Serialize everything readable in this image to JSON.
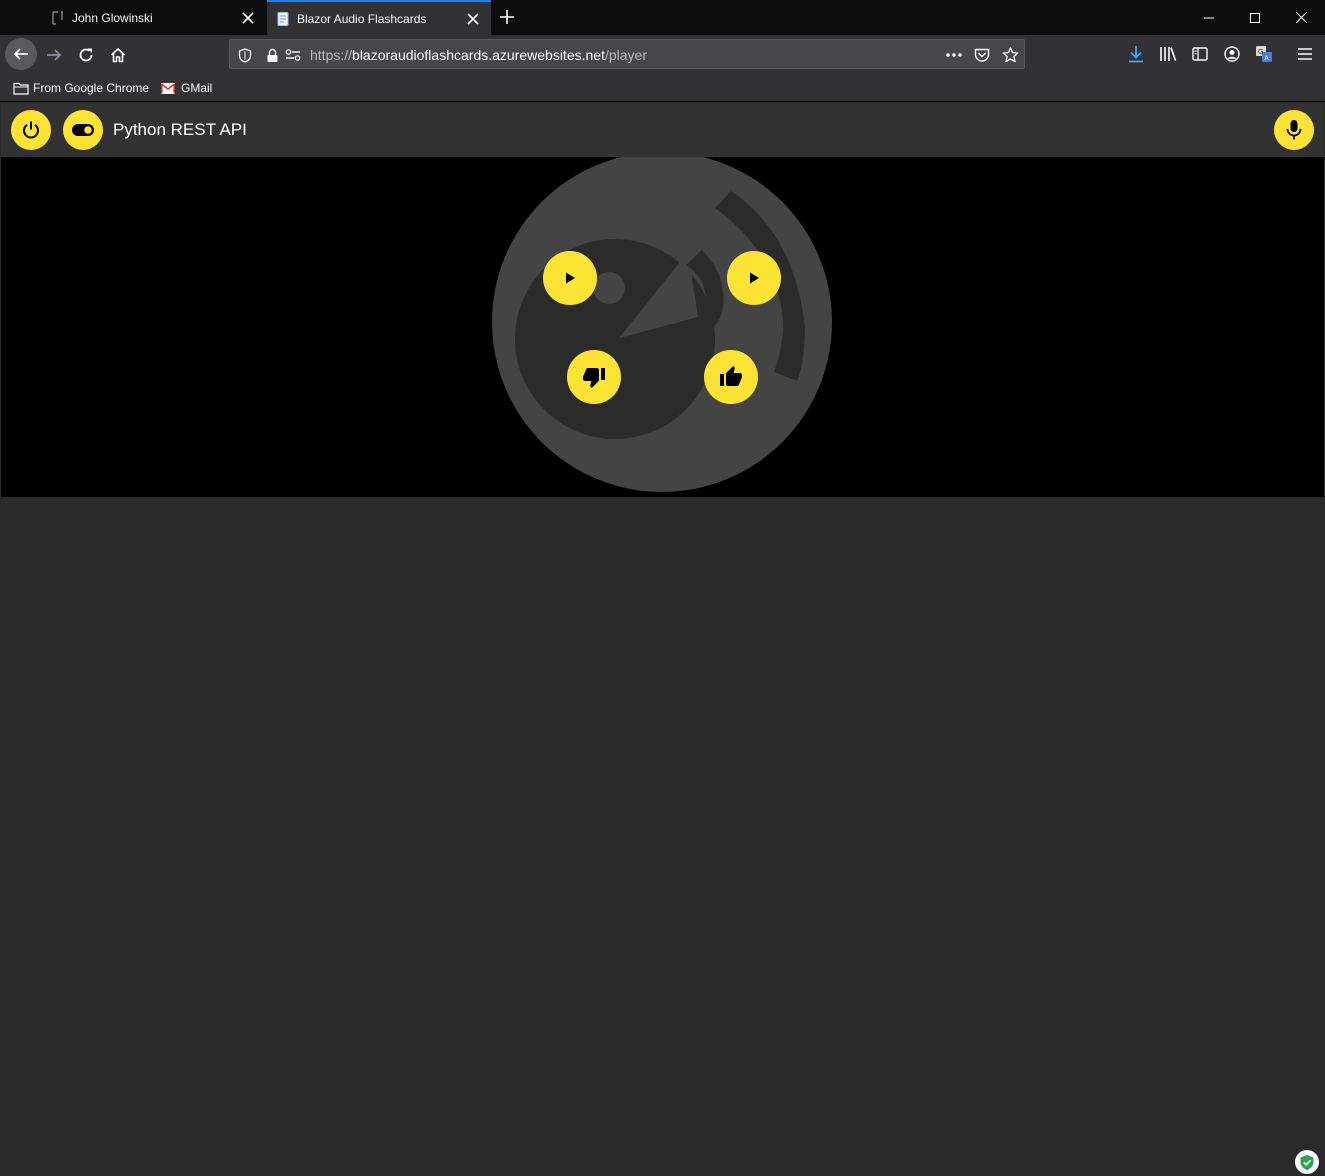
{
  "browser": {
    "tabs": [
      {
        "title": "John Glowinski",
        "favicon": "page-icon",
        "active": false
      },
      {
        "title": "Blazor Audio Flashcards",
        "favicon": "document-icon",
        "active": true
      }
    ],
    "url": {
      "scheme": "https://",
      "host": "blazoraudioflashcards.azurewebsites.net",
      "path": "/player"
    },
    "bookmarks": [
      {
        "label": "From Google Chrome",
        "icon": "folder-icon"
      },
      {
        "label": "GMail",
        "icon": "gmail-icon"
      }
    ],
    "colors": {
      "active_tab_accent": "#0a84ff",
      "download_icon": "#45a1ff"
    }
  },
  "app": {
    "title": "Python REST API",
    "accent_color": "#fde334",
    "toolbar": {
      "left_icons": [
        "power-icon",
        "toggle-icon"
      ],
      "right_icons": [
        "microphone-icon"
      ]
    },
    "player": {
      "controls": [
        "play-icon",
        "play-icon",
        "thumbs-down-icon",
        "thumbs-up-icon"
      ]
    }
  }
}
